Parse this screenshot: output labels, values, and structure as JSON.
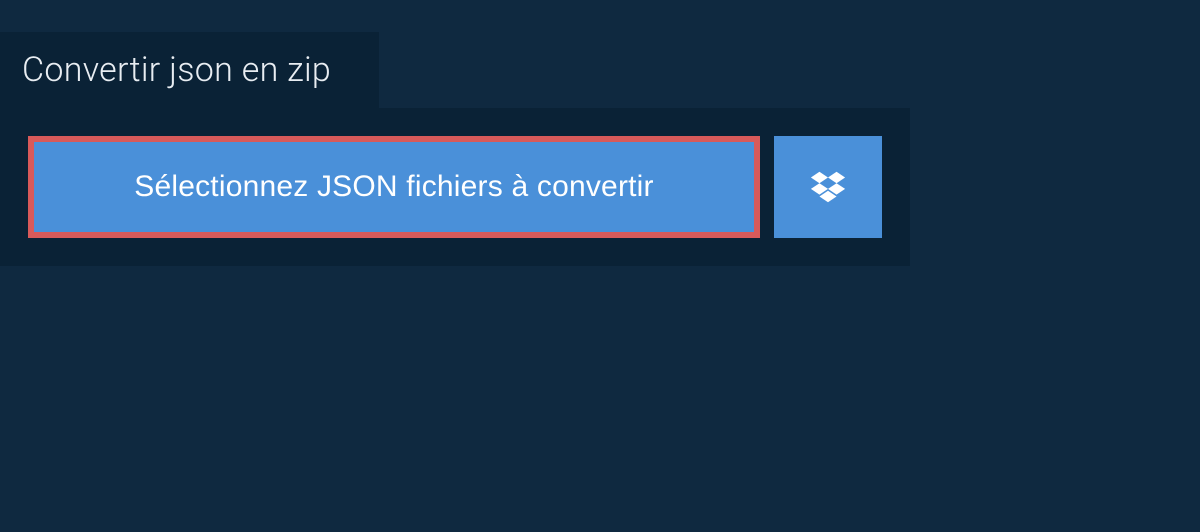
{
  "tab": {
    "title": "Convertir json en zip"
  },
  "actions": {
    "select_files_label": "Sélectionnez JSON fichiers à convertir"
  },
  "colors": {
    "background": "#0f2940",
    "panel": "#0a2236",
    "accent": "#4a90d9",
    "highlight_border": "#d85a5a"
  },
  "icons": {
    "dropbox": "dropbox-icon"
  }
}
